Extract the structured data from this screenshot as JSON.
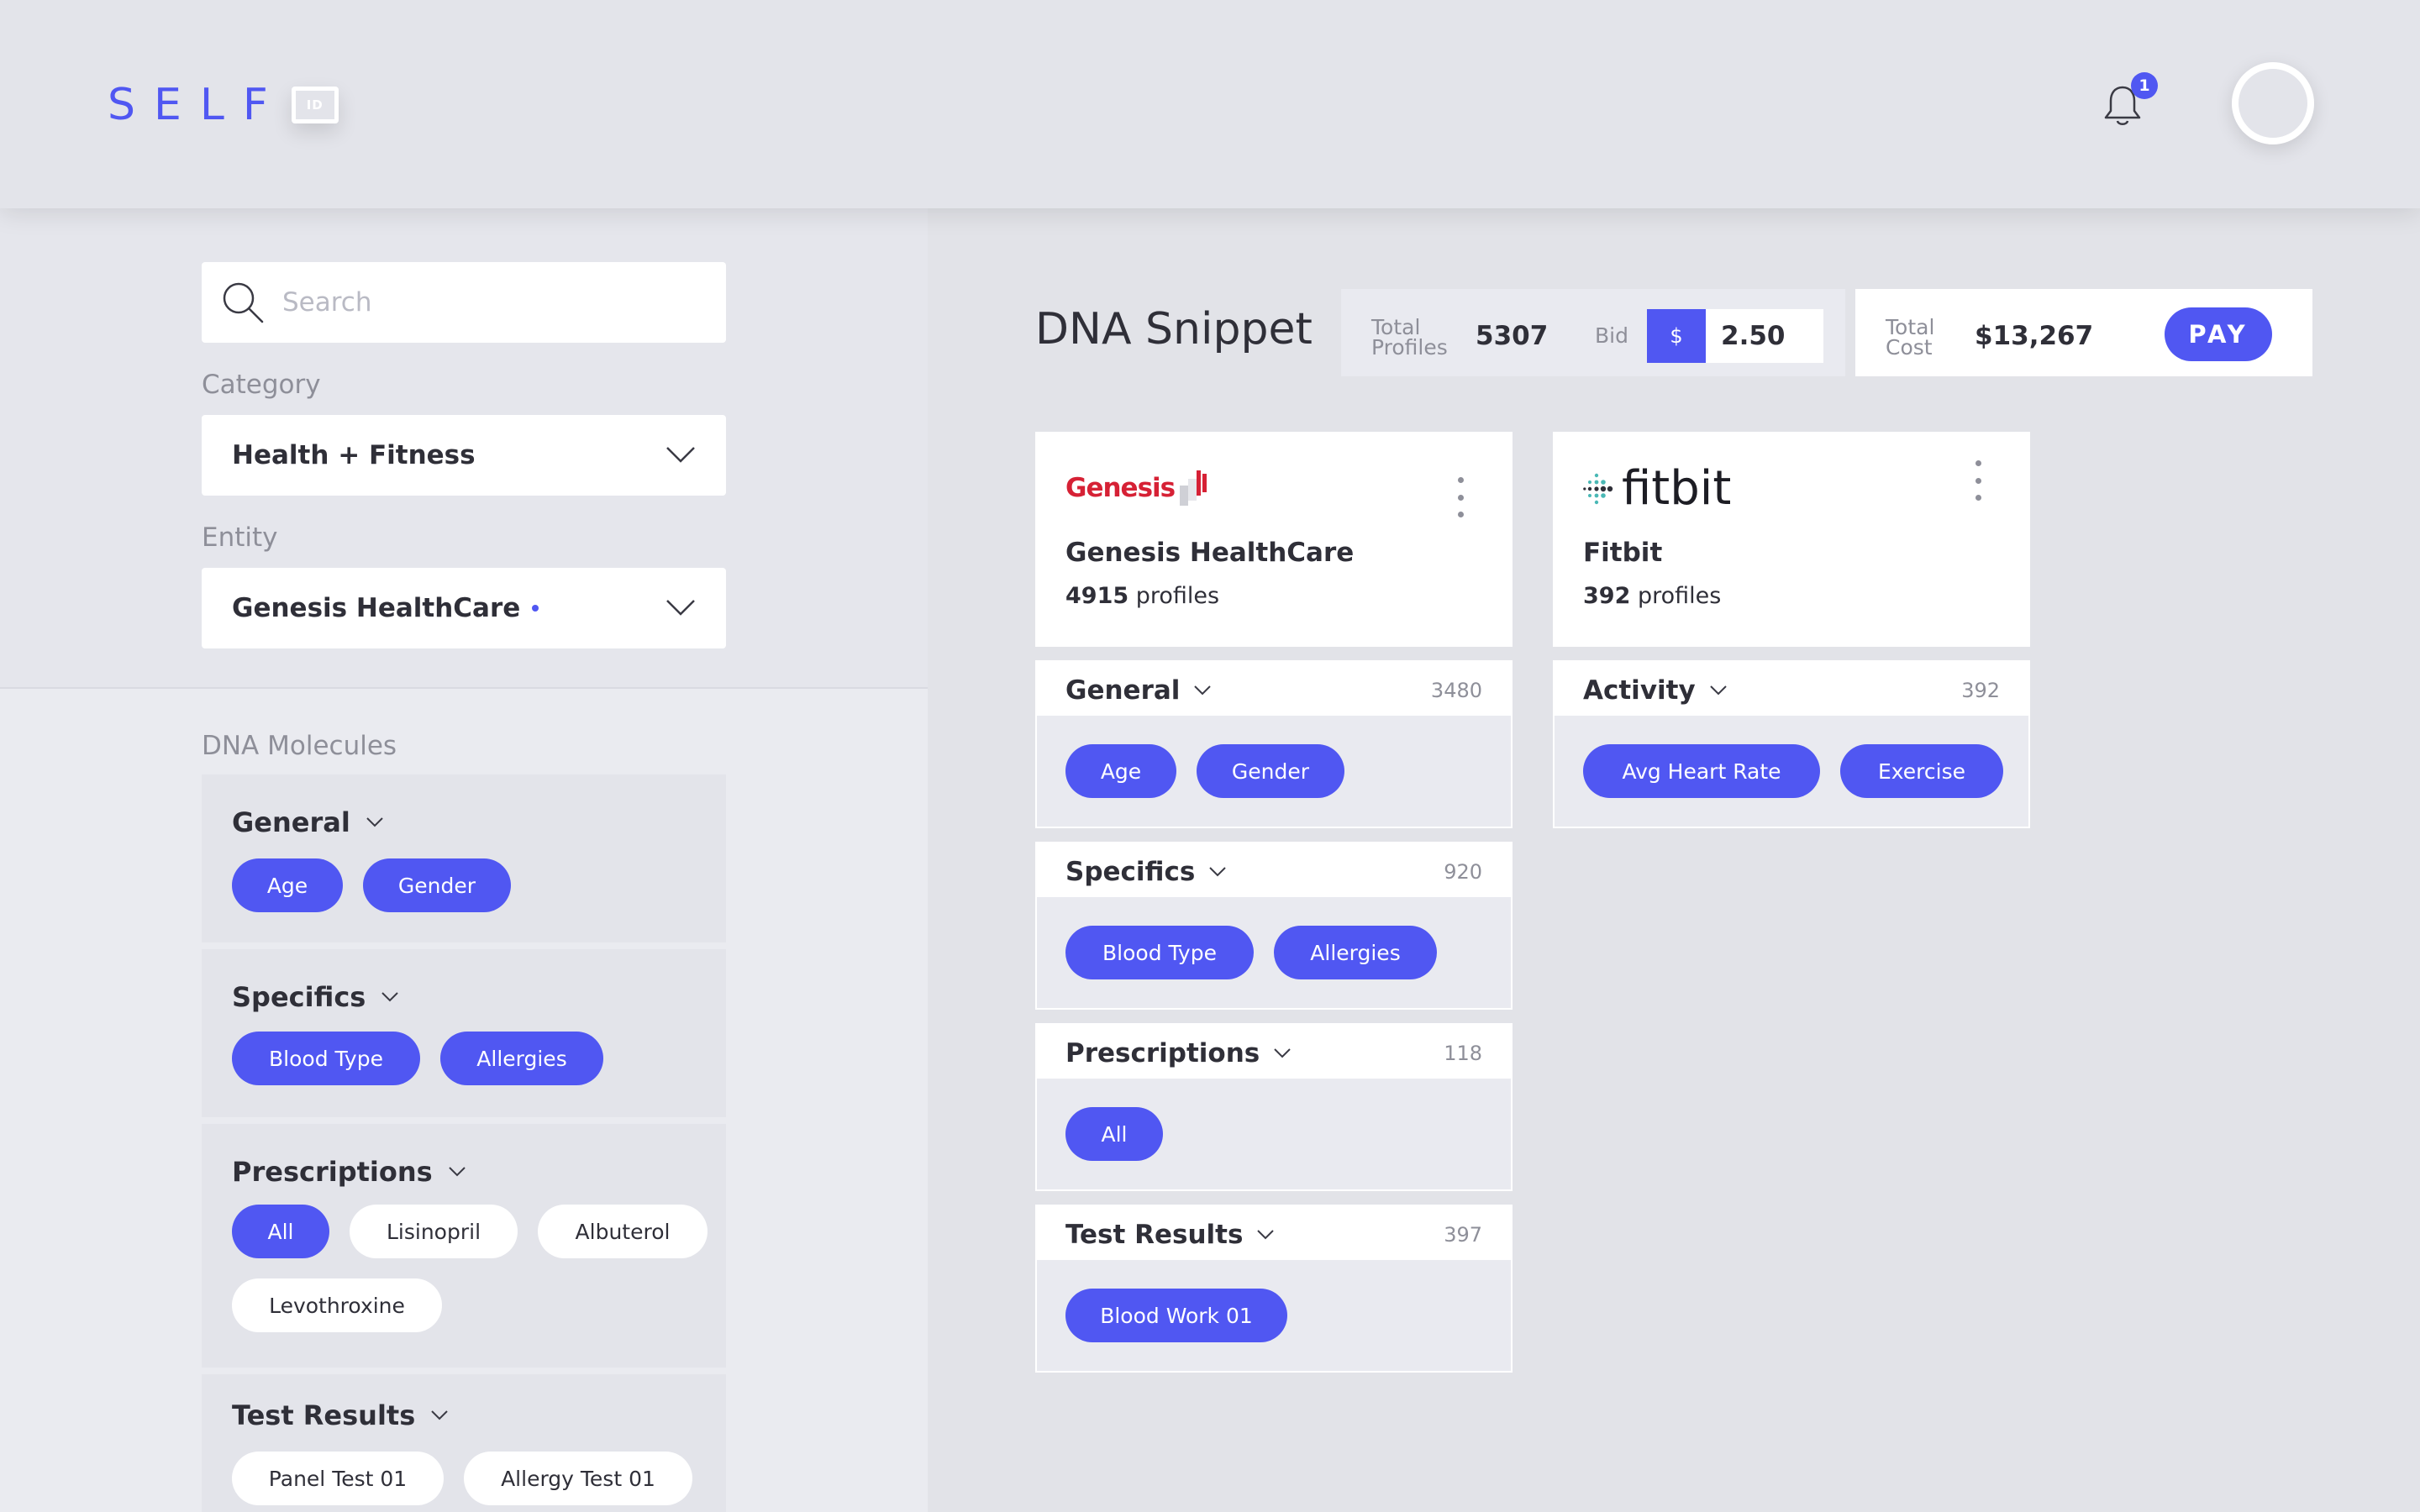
{
  "brand": {
    "name": "SELF",
    "badge": "ID",
    "accent": "#5057f2"
  },
  "header": {
    "notifications_count": "1"
  },
  "sidebar": {
    "search": {
      "placeholder": "Search"
    },
    "category": {
      "label": "Category",
      "value": "Health + Fitness"
    },
    "entity": {
      "label": "Entity",
      "value": "Genesis HealthCare"
    },
    "molecules_label": "DNA Molecules",
    "groups": [
      {
        "title": "General",
        "chips": [
          {
            "label": "Age",
            "selected": true
          },
          {
            "label": "Gender",
            "selected": true
          }
        ]
      },
      {
        "title": "Specifics",
        "chips": [
          {
            "label": "Blood Type",
            "selected": true
          },
          {
            "label": "Allergies",
            "selected": true
          }
        ]
      },
      {
        "title": "Prescriptions",
        "chips": [
          {
            "label": "All",
            "selected": true
          },
          {
            "label": "Lisinopril",
            "selected": false
          },
          {
            "label": "Albuterol",
            "selected": false
          },
          {
            "label": "Levothroxine",
            "selected": false
          }
        ]
      },
      {
        "title": "Test Results",
        "chips": [
          {
            "label": "Panel Test 01",
            "selected": false
          },
          {
            "label": "Allergy Test 01",
            "selected": false
          }
        ]
      }
    ]
  },
  "snippet": {
    "title": "DNA Snippet",
    "total_profiles_label_1": "Total",
    "total_profiles_label_2": "Profiles",
    "total_profiles": "5307",
    "bid_label": "Bid",
    "bid_currency": "$",
    "bid_value": "2.50",
    "total_cost_label_1": "Total",
    "total_cost_label_2": "Cost",
    "total_cost": "$13,267",
    "pay_label": "PAY"
  },
  "entities": [
    {
      "logo_text": "Genesis",
      "name": "Genesis HealthCare",
      "profiles_count": "4915",
      "profiles_label": "profiles",
      "sections": [
        {
          "title": "General",
          "count": "3480",
          "chips": [
            "Age",
            "Gender"
          ]
        },
        {
          "title": "Specifics",
          "count": "920",
          "chips": [
            "Blood Type",
            "Allergies"
          ]
        },
        {
          "title": "Prescriptions",
          "count": "118",
          "chips": [
            "All"
          ]
        },
        {
          "title": "Test Results",
          "count": "397",
          "chips": [
            "Blood Work 01"
          ]
        }
      ]
    },
    {
      "logo_text": "fitbit",
      "name": "Fitbit",
      "profiles_count": "392",
      "profiles_label": "profiles",
      "sections": [
        {
          "title": "Activity",
          "count": "392",
          "chips": [
            "Avg Heart Rate",
            "Exercise"
          ]
        }
      ]
    }
  ]
}
